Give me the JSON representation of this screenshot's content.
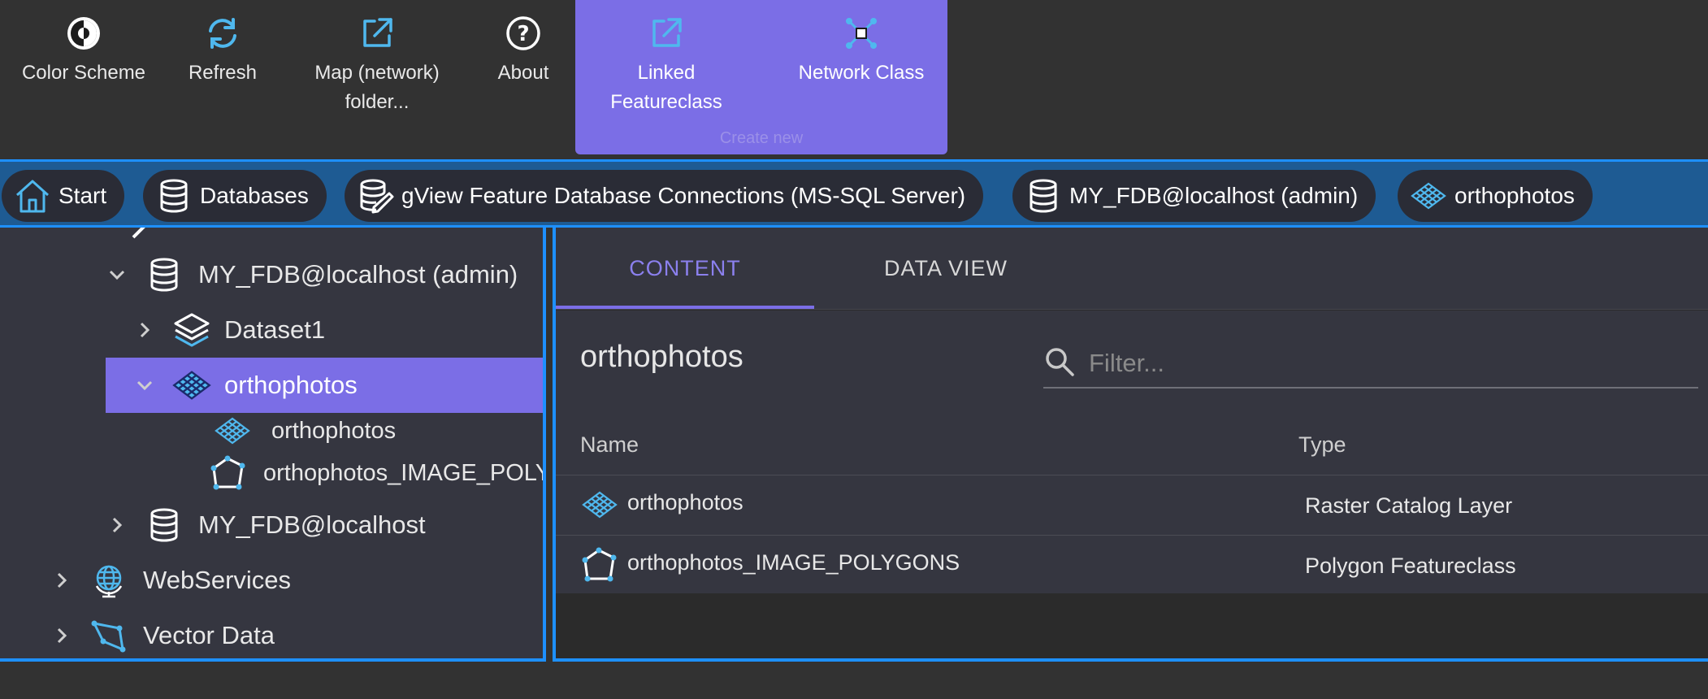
{
  "toolbar": {
    "color_scheme": "Color Scheme",
    "refresh": "Refresh",
    "map_folder": "Map (network)\nfolder...",
    "about": "About",
    "linked_featureclass": "Linked\nFeatureclass",
    "network_class": "Network Class",
    "create_new_caption": "Create new"
  },
  "breadcrumb": [
    {
      "label": "Start",
      "icon": "home-icon"
    },
    {
      "label": "Databases",
      "icon": "database-icon"
    },
    {
      "label": "gView Feature Database Connections (MS-SQL Server)",
      "icon": "database-edit-icon"
    },
    {
      "label": "MY_FDB@localhost (admin)",
      "icon": "database-icon"
    },
    {
      "label": "orthophotos",
      "icon": "raster-catalog-icon"
    }
  ],
  "tree": {
    "nodes": [
      {
        "label": "MY_FDB@localhost (admin)",
        "expanded": true
      },
      {
        "label": "Dataset1",
        "expanded": false
      },
      {
        "label": "orthophotos",
        "expanded": true,
        "selected": true
      },
      {
        "label": "orthophotos"
      },
      {
        "label": "orthophotos_IMAGE_POLYGONS"
      },
      {
        "label": "MY_FDB@localhost",
        "expanded": false
      },
      {
        "label": "WebServices",
        "expanded": false
      },
      {
        "label": "Vector Data",
        "expanded": false
      }
    ]
  },
  "tabs": {
    "content": "CONTENT",
    "data_view": "DATA VIEW",
    "active": "CONTENT"
  },
  "content": {
    "title": "orthophotos",
    "filter_placeholder": "Filter...",
    "filter_value": "",
    "columns": {
      "name": "Name",
      "type": "Type"
    },
    "rows": [
      {
        "name": "orthophotos",
        "type": "Raster Catalog Layer",
        "icon": "raster-catalog-icon"
      },
      {
        "name": "orthophotos_IMAGE_POLYGONS",
        "type": "Polygon Featureclass",
        "icon": "polygon-icon"
      }
    ]
  },
  "colors": {
    "accent": "#7b6ee6",
    "highlight_blue": "#1e90ff",
    "icon_blue": "#4fb8ee"
  }
}
